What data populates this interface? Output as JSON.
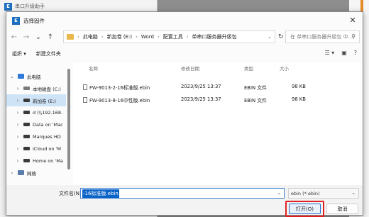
{
  "background_window": {
    "title": "串口升级助手",
    "logo_letter": "E"
  },
  "dialog": {
    "title": "选择固件",
    "logo_letter": "E",
    "close_glyph": "✕",
    "nav": {
      "back": "←",
      "forward": "→",
      "recent": "⌄",
      "up": "↑"
    },
    "breadcrumb": [
      "此电脑",
      "新加卷 (E:)",
      "Word",
      "配置工具",
      "单串口服务器升级包"
    ],
    "search_placeholder": "在 单串口服务器升级包 中...",
    "toolbar": {
      "organize": "组织 ▾",
      "new_folder": "新建文件夹"
    },
    "sidebar": [
      {
        "label": "此电脑",
        "expanded": true,
        "icon": "pc-icon",
        "level": 0
      },
      {
        "label": "本地磁盘 (C:)",
        "icon": "drive-icon",
        "level": 1
      },
      {
        "label": "新加卷 (E:)",
        "icon": "drive-icon",
        "level": 1,
        "selected": true
      },
      {
        "label": "d (\\\\192.168.",
        "icon": "network-drive-icon",
        "level": 1
      },
      {
        "label": "Data on 'Mac",
        "icon": "network-drive-icon",
        "level": 1
      },
      {
        "label": "Marques HD",
        "icon": "network-drive-icon",
        "level": 1
      },
      {
        "label": "iCloud on 'M",
        "icon": "network-drive-icon",
        "level": 1
      },
      {
        "label": "Home on 'Ma",
        "icon": "network-drive-icon",
        "level": 1
      },
      {
        "label": "网络",
        "icon": "network-icon",
        "level": 0
      }
    ],
    "columns": {
      "name": "名称",
      "date": "修改日期",
      "type": "类型",
      "size": "大小"
    },
    "files": [
      {
        "name": "FW-9013-2-16标准版.ebin",
        "date": "2023/9/25 13:37",
        "type": "EBIN 文件",
        "size": "98 KB"
      },
      {
        "name": "FW-9013-8-16中性版.ebin",
        "date": "2023/9/25 13:37",
        "type": "EBIN 文件",
        "size": "98 KB"
      }
    ],
    "filename_label": "文件名(N):",
    "filename_value": "-16标准版.ebin",
    "filetype": "ebin (*.ebin)",
    "open_button": "打开(O)",
    "cancel_button": "取消"
  },
  "colors": {
    "accent": "#0a64c8",
    "highlight_box": "#e02020",
    "selected_nav": "#cfe3f7"
  }
}
